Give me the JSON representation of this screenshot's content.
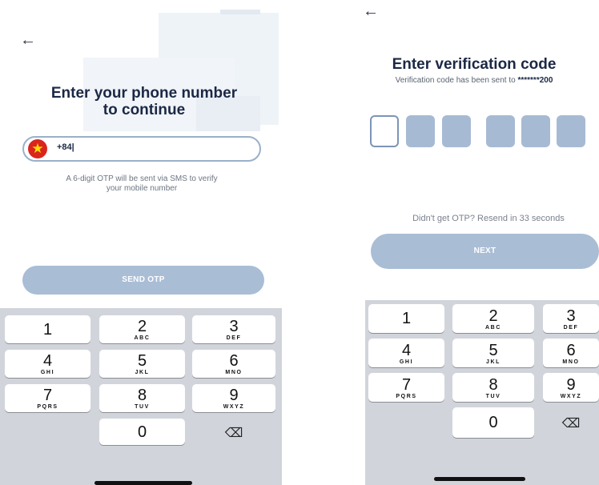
{
  "screen1": {
    "back_icon": "←",
    "title_line1": "Enter your phone number",
    "title_line2": "to continue",
    "country_flag_icon": "★",
    "phone_value": "+84|",
    "helper_line1": "A 6-digit OTP will be sent via SMS to verify",
    "helper_line2": "your mobile number",
    "send_button": "SEND OTP"
  },
  "screen2": {
    "back_icon": "←",
    "title": "Enter verification code",
    "subtitle_prefix": "Verification code has been sent to ",
    "masked_phone": "*******200",
    "otp_digits": [
      "",
      "",
      "",
      "",
      "",
      ""
    ],
    "resend_text": "Didn't get OTP? Resend in 33 seconds",
    "next_button": "NEXT"
  },
  "keypad": {
    "keys": [
      {
        "digit": "1",
        "letters": ""
      },
      {
        "digit": "2",
        "letters": "ABC"
      },
      {
        "digit": "3",
        "letters": "DEF"
      },
      {
        "digit": "4",
        "letters": "GHI"
      },
      {
        "digit": "5",
        "letters": "JKL"
      },
      {
        "digit": "6",
        "letters": "MNO"
      },
      {
        "digit": "7",
        "letters": "PQRS"
      },
      {
        "digit": "8",
        "letters": "TUV"
      },
      {
        "digit": "9",
        "letters": "WXYZ"
      },
      {
        "digit": "0",
        "letters": ""
      }
    ],
    "backspace_icon": "⌫"
  },
  "colors": {
    "primary_disabled": "#a9bdd5",
    "otp_box": "#a7bad3",
    "text_dark": "#1b2845",
    "keypad_bg": "#d1d5db",
    "flag_red": "#da251d",
    "flag_star": "#ffde00"
  }
}
